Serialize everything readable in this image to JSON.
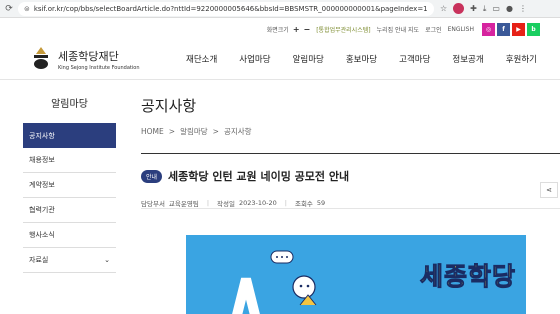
{
  "browser": {
    "url": "ksif.or.kr/cop/bbs/selectBoardArticle.do?nttId=9220000005646&bbsId=BBSMSTR_000000000001&pageIndex=1"
  },
  "util": {
    "zoom_label": "화면크기",
    "zoom_in": "+",
    "zoom_out": "−",
    "integrated": "[통합업무관리시스템]",
    "sitemap": "누리집 안내 지도",
    "login": "로그인",
    "english": "ENGLISH"
  },
  "logo": {
    "ko": "세종학당재단",
    "en": "King Sejong Institute Foundation"
  },
  "gnb": [
    "재단소개",
    "사업마당",
    "알림마당",
    "홍보마당",
    "고객마당",
    "정보공개",
    "후원하기"
  ],
  "lnb": {
    "title": "알림마당",
    "items": [
      {
        "label": "공지사항",
        "active": true
      },
      {
        "label": "채용정보"
      },
      {
        "label": "계약정보"
      },
      {
        "label": "협력기관"
      },
      {
        "label": "행사소식"
      },
      {
        "label": "자료실",
        "expandable": true
      }
    ]
  },
  "content": {
    "title": "공지사항",
    "breadcrumb": [
      "HOME",
      ">",
      "알림마당",
      ">",
      "공지사항"
    ],
    "badge": "안내",
    "post_title": "세종학당 인턴 교원 네이밍 공모전 안내",
    "meta": {
      "dept_label": "담당부서",
      "dept": "교육운영팀",
      "date_label": "작성일",
      "date": "2023-10-20",
      "views_label": "조회수",
      "views": "59"
    },
    "banner_text": "세종학당"
  },
  "colors": {
    "navy": "#2b3e7e",
    "banner_blue": "#3aa4e2",
    "banner_yellow": "#ffe23a"
  }
}
